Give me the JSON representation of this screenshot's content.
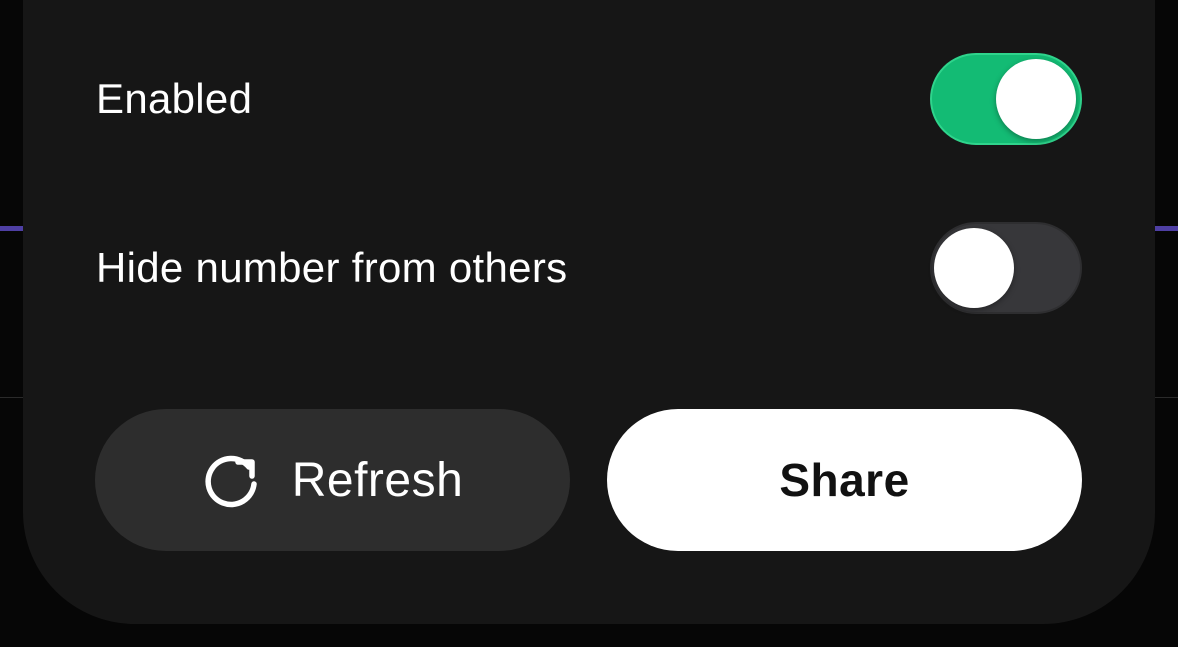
{
  "settings": {
    "enabled": {
      "label": "Enabled",
      "value": true,
      "on_color": "#13bb74"
    },
    "hide_number": {
      "label": "Hide number from others",
      "value": false,
      "off_color": "#37373a"
    }
  },
  "actions": {
    "refresh": {
      "label": "Refresh",
      "icon": "refresh-icon"
    },
    "share": {
      "label": "Share"
    }
  },
  "colors": {
    "sheet_background": "#161616",
    "accent_line": "#4e3fa3"
  }
}
